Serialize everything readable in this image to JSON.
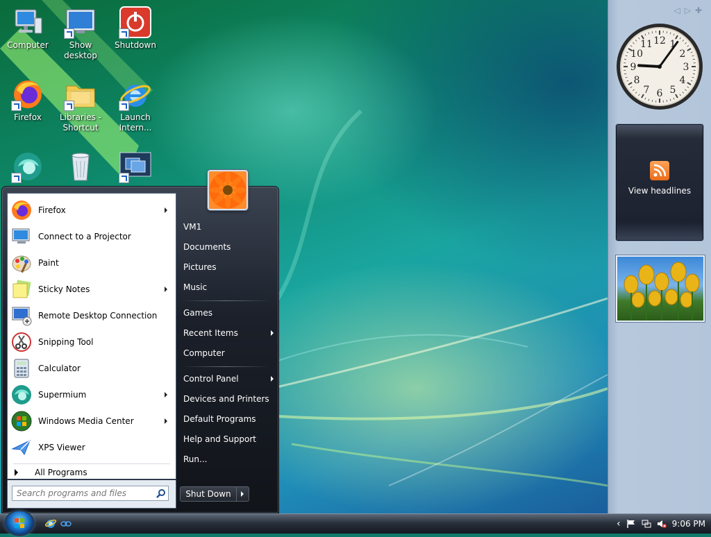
{
  "desktop": {
    "icons": [
      {
        "label": "Computer",
        "icon": "computer-icon"
      },
      {
        "label": "Show desktop",
        "icon": "show-desktop-icon"
      },
      {
        "label": "Shutdown",
        "icon": "power-icon"
      },
      {
        "label": "Firefox",
        "icon": "firefox-icon"
      },
      {
        "label": "Libraries - Shortcut",
        "icon": "folder-icon"
      },
      {
        "label": "Launch Intern...",
        "icon": "ie-icon"
      },
      {
        "label": "",
        "icon": "supermium-icon"
      },
      {
        "label": "",
        "icon": "recycle-bin-icon"
      },
      {
        "label": "",
        "icon": "switch-windows-icon"
      }
    ]
  },
  "start_menu": {
    "programs": [
      {
        "label": "Firefox",
        "icon": "firefox-icon",
        "submenu": true
      },
      {
        "label": "Connect to a Projector",
        "icon": "projector-icon",
        "submenu": false
      },
      {
        "label": "Paint",
        "icon": "paint-icon",
        "submenu": false
      },
      {
        "label": "Sticky Notes",
        "icon": "sticky-notes-icon",
        "submenu": true
      },
      {
        "label": "Remote Desktop Connection",
        "icon": "remote-desktop-icon",
        "submenu": false
      },
      {
        "label": "Snipping Tool",
        "icon": "snipping-tool-icon",
        "submenu": false
      },
      {
        "label": "Calculator",
        "icon": "calculator-icon",
        "submenu": false
      },
      {
        "label": "Supermium",
        "icon": "supermium-icon",
        "submenu": true
      },
      {
        "label": "Windows Media Center",
        "icon": "media-center-icon",
        "submenu": true
      },
      {
        "label": "XPS Viewer",
        "icon": "xps-viewer-icon",
        "submenu": false
      }
    ],
    "all_programs": "All Programs",
    "search_placeholder": "Search programs and files",
    "right_items": [
      {
        "label": "VM1",
        "submenu": false
      },
      {
        "label": "Documents",
        "submenu": false
      },
      {
        "label": "Pictures",
        "submenu": false
      },
      {
        "label": "Music",
        "submenu": false
      },
      {
        "label": "Games",
        "submenu": false
      },
      {
        "label": "Recent Items",
        "submenu": true
      },
      {
        "label": "Computer",
        "submenu": false
      },
      {
        "label": "Control Panel",
        "submenu": true
      },
      {
        "label": "Devices and Printers",
        "submenu": false
      },
      {
        "label": "Default Programs",
        "submenu": false
      },
      {
        "label": "Help and Support",
        "submenu": false
      },
      {
        "label": "Run...",
        "submenu": false
      }
    ],
    "shutdown_label": "Shut Down"
  },
  "sidebar": {
    "clock": {
      "hour": 9,
      "minute": 6,
      "numerals": [
        "12",
        "1",
        "2",
        "3",
        "4",
        "5",
        "6",
        "7",
        "8",
        "9",
        "10",
        "11"
      ]
    },
    "feeds_label": "View headlines"
  },
  "taskbar": {
    "time": "9:06 PM",
    "accent": "#1a74c8"
  }
}
